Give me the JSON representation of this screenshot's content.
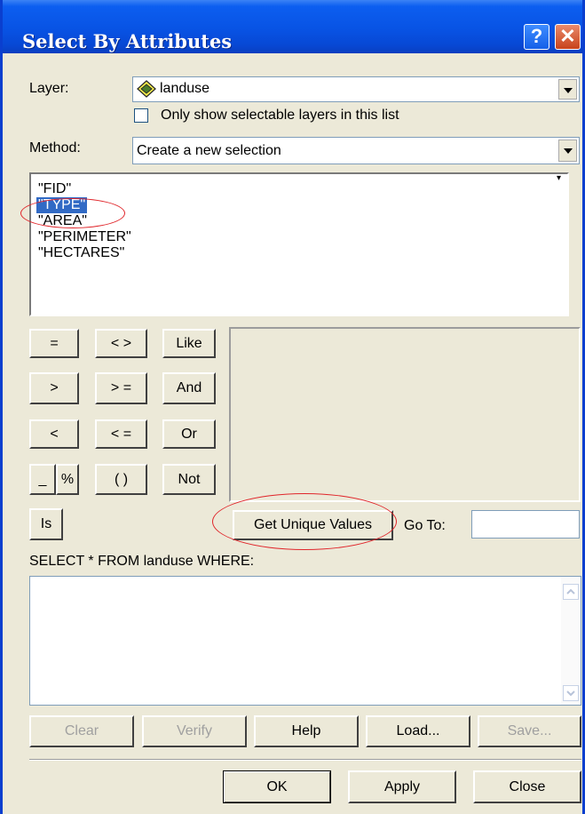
{
  "window": {
    "title": "Select By Attributes"
  },
  "title_buttons": {
    "help": "?",
    "close": "✕"
  },
  "layer": {
    "label": "Layer:",
    "value": "landuse"
  },
  "only_selectable": {
    "label": "Only show selectable layers in this list",
    "checked": false
  },
  "method": {
    "label": "Method:",
    "value": "Create a new selection"
  },
  "fields": [
    "\"FID\"",
    "\"TYPE\"",
    "\"AREA\"",
    "\"PERIMETER\"",
    "\"HECTARES\""
  ],
  "selected_field": "\"TYPE\"",
  "operators": {
    "eq": "=",
    "ne": "< >",
    "like": "Like",
    "gt": ">",
    "ge": "> =",
    "and": "And",
    "lt": "<",
    "le": "< =",
    "or": "Or",
    "underscore": "_",
    "percent": "%",
    "parens": "( )",
    "not": "Not",
    "is": "Is"
  },
  "get_unique_values": "Get Unique Values",
  "goto": {
    "label": "Go To:",
    "value": ""
  },
  "query_label": "SELECT * FROM landuse WHERE:",
  "query_text": "",
  "action_buttons": {
    "clear": "Clear",
    "verify": "Verify",
    "help": "Help",
    "load": "Load...",
    "save": "Save..."
  },
  "dialog_buttons": {
    "ok": "OK",
    "apply": "Apply",
    "close": "Close"
  },
  "colors": {
    "titlebar": "#0853e4",
    "dialog_bg": "#ece9d8",
    "selection": "#316ac5",
    "annotation": "#e0262b"
  }
}
